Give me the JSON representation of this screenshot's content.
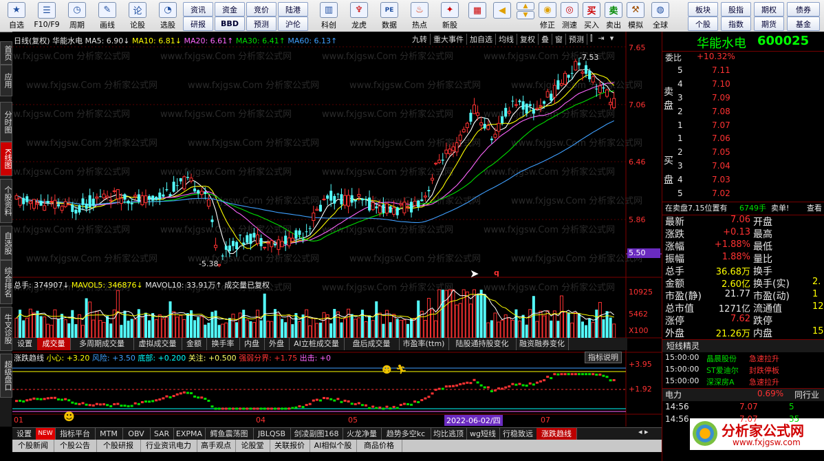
{
  "toolbar": {
    "main_buttons": [
      {
        "icon": "star-icon",
        "label": "自选"
      },
      {
        "icon": "list-icon",
        "label": "F10/F9"
      },
      {
        "icon": "clock-icon",
        "label": "周期"
      },
      {
        "icon": "pen-icon",
        "label": "画线"
      },
      {
        "icon": "formula-icon",
        "label": "论股"
      },
      {
        "icon": "chart-icon",
        "label": "选股"
      }
    ],
    "small_buttons": [
      "资讯",
      "资金",
      "竞价",
      "陆港",
      "研报",
      "BBD",
      "预测",
      "沪伦"
    ],
    "mid_buttons": [
      {
        "icon": "kline-icon",
        "label": "科创"
      },
      {
        "icon": "dragon-icon",
        "label": "龙虎"
      },
      {
        "icon": "pe-icon",
        "label": "数据"
      },
      {
        "icon": "fire-icon",
        "label": "热点"
      },
      {
        "icon": "new-icon",
        "label": "新股"
      }
    ],
    "right_buttons": [
      {
        "icon": "grid-icon",
        "label": ""
      },
      {
        "icon": "arrow-left-icon",
        "label": ""
      },
      {
        "icon": "arrow-up-icon",
        "label": ""
      },
      {
        "icon": "arrow-down-icon",
        "label": ""
      },
      {
        "icon": "correct-icon",
        "label": "修正"
      },
      {
        "icon": "speed-icon",
        "label": "测速"
      },
      {
        "icon": "buy-icon",
        "label": "买入"
      },
      {
        "icon": "sell-icon",
        "label": "卖出"
      },
      {
        "icon": "hammer-icon",
        "label": "模拟"
      },
      {
        "icon": "globe-icon",
        "label": "全球"
      }
    ],
    "right_small": [
      "板块",
      "股指",
      "期权",
      "债券",
      "个股",
      "指数",
      "期货",
      "基金"
    ],
    "buy_glyph": "买",
    "sell_glyph": "卖",
    "pe_glyph": "PE",
    "formula_glyph": "论"
  },
  "left_tabs": [
    "首页",
    "应用",
    "分时图",
    "K线图",
    "个股资料",
    "自选股",
    "综合排名",
    "牛叉诊股",
    "超级盘口"
  ],
  "chart_header": {
    "period": "日线(复权)",
    "stock": "华能水电",
    "ma5": "MA5: 6.90↓",
    "ma10": "MA10: 6.81↓",
    "ma20": "MA20: 6.61↑",
    "ma30": "MA30: 6.41↑",
    "ma60": "MA60: 6.13↑",
    "buttons": [
      "九转",
      "重大事件",
      "加自选",
      "均线",
      "复权",
      "叠",
      "窗",
      "预测"
    ]
  },
  "price_axis": [
    "7.65",
    "7.06",
    "6.46",
    "5.86",
    "5.50"
  ],
  "price_marks": {
    "high": "7.53",
    "low": "5.38"
  },
  "watermark": "www.fxjgsw.Com 分析家公式网",
  "volume_header": {
    "total": "总手: 374907↓",
    "mavol5": "MAVOL5: 346876↓",
    "mavol10": "MAVOL10: 33.91万↑",
    "note": "成交量已复权"
  },
  "volume_axis": [
    "10925",
    "5462",
    "X100"
  ],
  "mid_tabs": [
    "设置",
    "成交量",
    "多周期成交量",
    "虚拟成交量",
    "金额",
    "换手率",
    "内盘",
    "外盘",
    "AI立桩成交量",
    "盘后成交量",
    "市盈率(ttm)",
    "陆股通持股变化",
    "融资融券变化"
  ],
  "indicator_header": {
    "name": "涨跌趋线",
    "xiaoxin": "小心: +3.20",
    "fengxian": "风险: +3.50",
    "dibu": "底部: +0.200",
    "guanzhu": "关注: +0.500",
    "qiangruo": "强弱分界: +1.75",
    "chuji": "出击: +0",
    "help": "指标说明"
  },
  "indicator_axis": [
    "+3.95",
    "+1.92"
  ],
  "time_axis": [
    "01",
    "04",
    "05",
    "07"
  ],
  "cursor_date": "2022-06-02/四",
  "bottom_tabs": [
    "设置",
    "NEW",
    "指标平台",
    "MTM",
    "OBV",
    "SAR",
    "EXPMA",
    "鳄鱼震荡图",
    "JBLQSB",
    "剑凌副图168",
    "火龙净量",
    "趋势多空kc",
    "均比逃顶",
    "wg短线",
    "行稳致远",
    "涨跌趋线"
  ],
  "status_tabs": [
    "个股新闻",
    "个股公告",
    "个股研报",
    "行业资讯电力",
    "高手观点",
    "论股堂",
    "关联报价",
    "AI相似个股",
    "商品价格"
  ],
  "quote": {
    "name": "华能水电",
    "code": "600025",
    "r": "R",
    "weibi_label": "委比",
    "weibi": "+10.32%",
    "sell_label": "卖盘",
    "buy_label": "买盘",
    "sells": [
      [
        "5",
        "7.11"
      ],
      [
        "4",
        "7.10"
      ],
      [
        "3",
        "7.09"
      ],
      [
        "2",
        "7.08"
      ],
      [
        "1",
        "7.07"
      ]
    ],
    "buys": [
      [
        "1",
        "7.06"
      ],
      [
        "2",
        "7.05"
      ],
      [
        "3",
        "7.04"
      ],
      [
        "4",
        "7.03"
      ],
      [
        "5",
        "7.02"
      ]
    ],
    "notice": "在卖盘7.15位置有",
    "notice_vol": "6749手",
    "notice_tag": "卖单!",
    "notice_more": "查看",
    "stats": [
      [
        "最新",
        "7.06",
        "开盘",
        ""
      ],
      [
        "涨跌",
        "+0.13",
        "最高",
        ""
      ],
      [
        "涨幅",
        "+1.88%",
        "最低",
        ""
      ],
      [
        "振幅",
        "1.88%",
        "量比",
        ""
      ],
      [
        "总手",
        "36.68万",
        "换手",
        ""
      ],
      [
        "金额",
        "2.60亿",
        "换手(实)",
        "2."
      ],
      [
        "市盈(静)",
        "21.77",
        "市盈(动)",
        "1"
      ],
      [
        "总市值",
        "1271亿",
        "流通值",
        "12"
      ],
      [
        "涨停",
        "7.62",
        "跌停",
        ""
      ],
      [
        "外盘",
        "21.26万",
        "内盘",
        "15.4"
      ]
    ],
    "short_title": "短线精灵",
    "short_items": [
      [
        "15:00:00",
        "晶晨股份",
        "急速拉升"
      ],
      [
        "15:00:00",
        "ST爱迪尔",
        "封跌停板"
      ],
      [
        "15:00:00",
        "深深房A",
        "急速拉升"
      ]
    ],
    "power_label": "电力",
    "power_pct": "0.69%",
    "power_rank": "同行业",
    "ticks": [
      [
        "14:56",
        "7.07",
        "5"
      ],
      [
        "14:56",
        "7.07",
        "35"
      ]
    ]
  },
  "logo_text": "分析家公式网",
  "logo_url": "www.fxjgsw.com"
}
